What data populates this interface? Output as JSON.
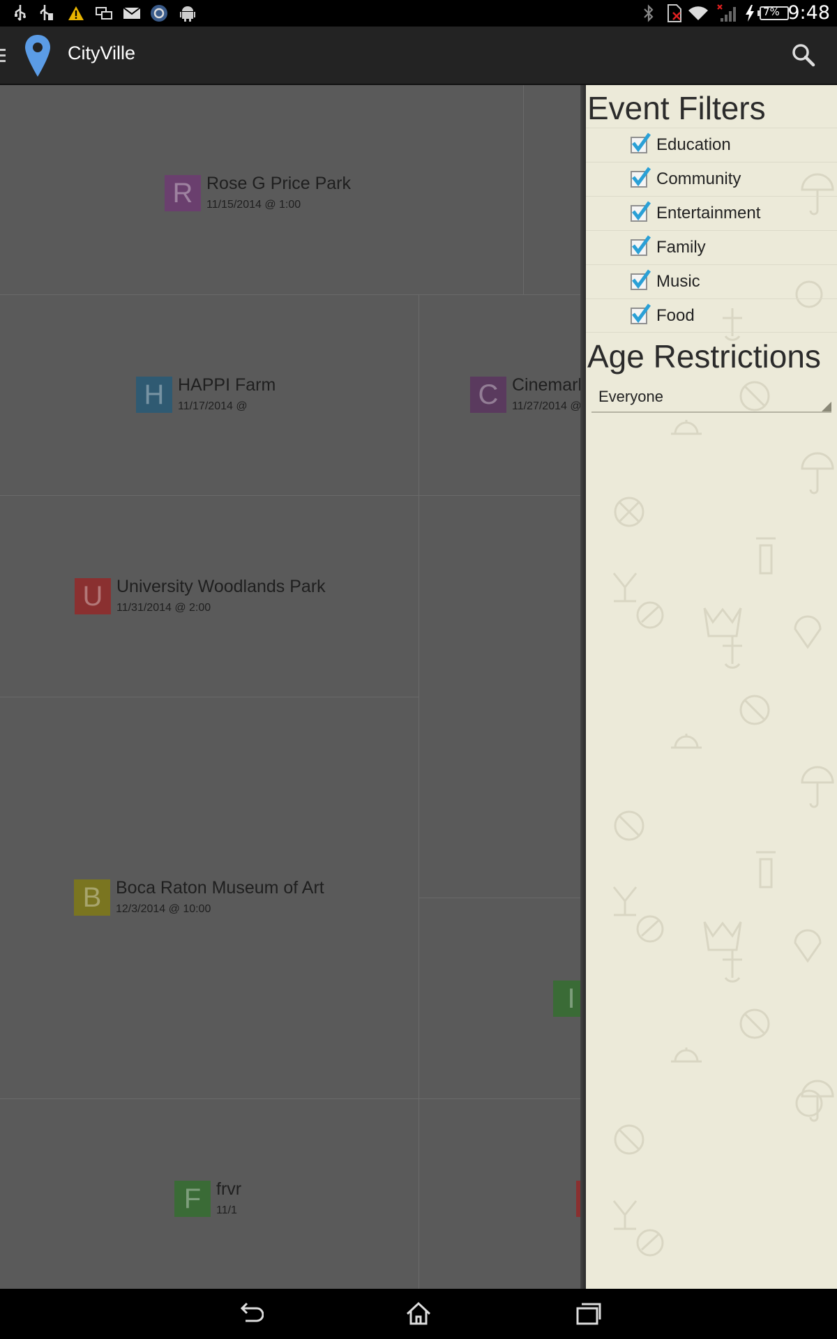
{
  "status_bar": {
    "time": "9:48",
    "battery_percent": "7%",
    "left_icons": [
      "usb-icon",
      "usb-debug-icon",
      "warning-icon",
      "screen-mirror-icon",
      "mail-icon",
      "sync-app-icon",
      "android-icon"
    ],
    "right_icons": [
      "bluetooth-icon",
      "no-sim-icon",
      "wifi-icon",
      "signal-icon",
      "charging-icon",
      "battery-icon"
    ]
  },
  "action_bar": {
    "title": "CityVille",
    "icons": [
      "menu-icon",
      "map-pin-icon",
      "search-icon"
    ]
  },
  "events": [
    {
      "letter": "R",
      "name": "Rose G Price Park",
      "date": "11/15/2014 @ 1:00",
      "color": "#6a3f6e"
    },
    {
      "letter": "H",
      "name": "HAPPI Farm",
      "date": "11/17/2014 @",
      "color": "#2f5a72"
    },
    {
      "letter": "C",
      "name": "Cinemark",
      "date": "11/27/2014 @",
      "color": "#5a3a5e"
    },
    {
      "letter": "U",
      "name": "University Woodlands Park",
      "date": "11/31/2014 @ 2:00",
      "color": "#8a3030"
    },
    {
      "letter": "B",
      "name": "Boca Raton Museum of Art",
      "date": "12/3/2014 @ 10:00",
      "color": "#7a7520"
    },
    {
      "letter": "I",
      "name": "",
      "date": "",
      "color": "#3a6b36"
    },
    {
      "letter": "F",
      "name": "frvr",
      "date": "11/1",
      "color": "#3a6b36"
    }
  ],
  "drawer": {
    "event_filters_heading": "Event Filters",
    "filters": [
      {
        "label": "Education",
        "checked": true
      },
      {
        "label": "Community",
        "checked": true
      },
      {
        "label": "Entertainment",
        "checked": true
      },
      {
        "label": "Family",
        "checked": true
      },
      {
        "label": "Music",
        "checked": true
      },
      {
        "label": "Food",
        "checked": true
      }
    ],
    "age_heading": "Age Restrictions",
    "age_selected": "Everyone",
    "check_color": "#2aa0d6"
  },
  "nav_bar": {
    "icons": [
      "back-icon",
      "home-icon",
      "recent-apps-icon"
    ]
  }
}
